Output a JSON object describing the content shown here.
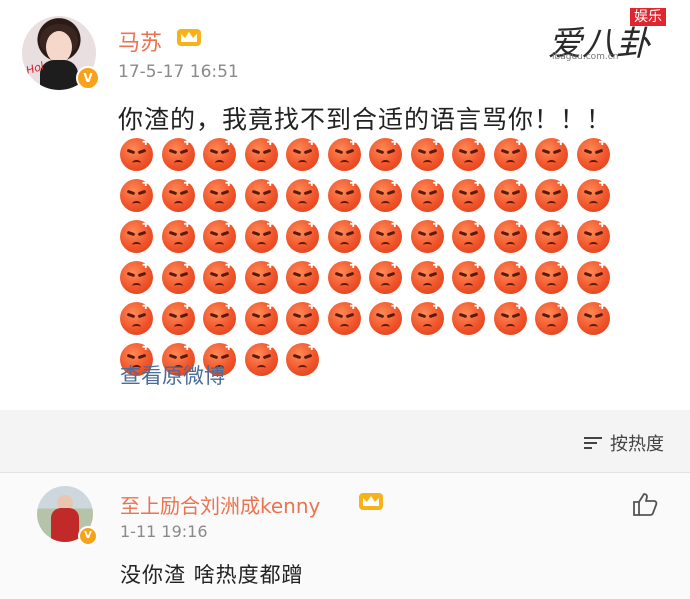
{
  "post": {
    "username": "马苏",
    "timestamp": "17-5-17 16:51",
    "text": "你渣的，我竟找不到合适的语言骂你！！！",
    "emoji_count": 65,
    "emoji_name": "angry-face",
    "view_original": "查看原微博",
    "avatar_signature": "Hol"
  },
  "sort": {
    "label": "按热度"
  },
  "comment": {
    "username": "至上励合刘洲成kenny",
    "timestamp": "1-11 19:16",
    "text": "没你渣 啥热度都蹭"
  },
  "watermark": {
    "brand": "爱八卦",
    "badge": "娱乐",
    "url": "ibaguu.com.cn"
  },
  "colors": {
    "username": "#eb7350",
    "link": "#4a6c96",
    "verified": "#f7a21b",
    "emoji": "#f0542a"
  }
}
